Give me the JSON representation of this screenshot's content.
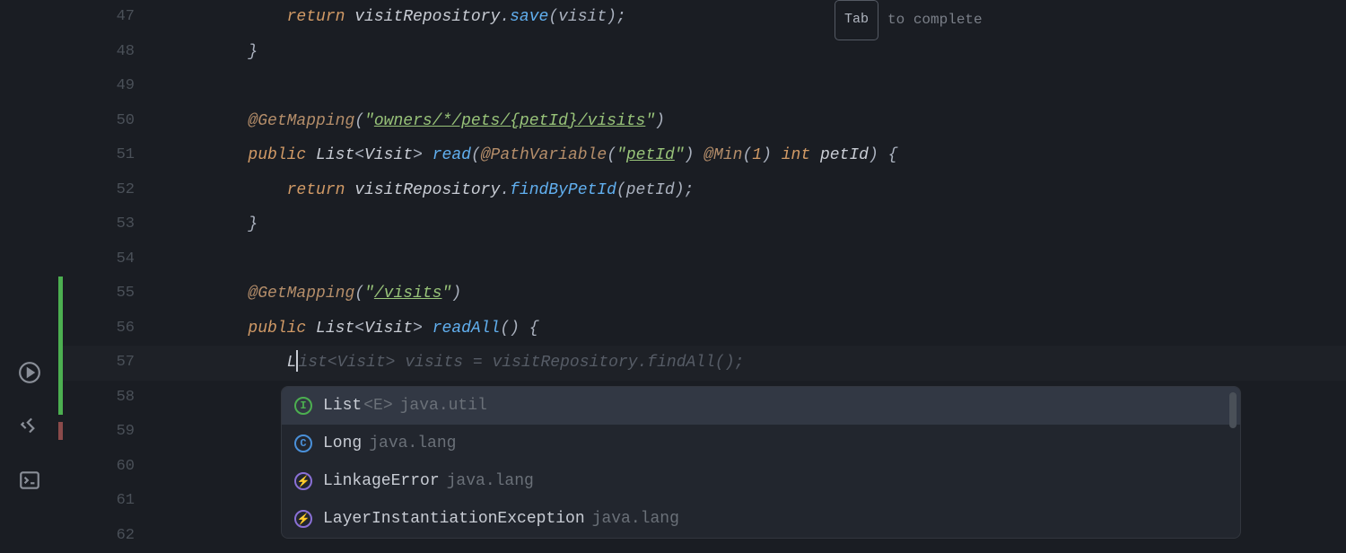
{
  "gutter": {
    "lines": [
      "47",
      "48",
      "49",
      "50",
      "51",
      "52",
      "53",
      "54",
      "55",
      "56",
      "57",
      "58",
      "59",
      "60",
      "61",
      "62"
    ],
    "markers": {
      "51": "web-icon",
      "56": "web-icon"
    },
    "change_bars": [
      {
        "from": "55",
        "to": "58",
        "kind": "add"
      },
      {
        "from": "59",
        "to": "59",
        "kind": "del"
      }
    ]
  },
  "code": {
    "l47": {
      "indent": "            ",
      "kw": "return",
      "sp": " ",
      "var": "visitRepository",
      "dot": ".",
      "method": "save",
      "args": "(visit);"
    },
    "l48": {
      "indent": "        ",
      "brace": "}"
    },
    "l49": {
      "text": ""
    },
    "l50": {
      "indent": "        ",
      "ann": "@GetMapping",
      "open": "(",
      "q1": "\"",
      "path": "owners/*/pets/{petId}/visits",
      "q2": "\"",
      "close": ")"
    },
    "l51": {
      "indent": "        ",
      "kw": "public",
      "sp": " ",
      "type1": "List",
      "lt": "<",
      "type2": "Visit",
      "gt": ">",
      "sp2": " ",
      "method": "read",
      "open": "(",
      "ann": "@PathVariable",
      "open2": "(",
      "q1": "\"",
      "pv": "petId",
      "q2": "\"",
      "close2": ")",
      "sp3": " ",
      "ann2": "@Min",
      "open3": "(",
      "num": "1",
      "close3": ")",
      "sp4": " ",
      "ptype": "int",
      "sp5": " ",
      "pname": "petId",
      "close": ") {"
    },
    "l52": {
      "indent": "            ",
      "kw": "return",
      "sp": " ",
      "var": "visitRepository",
      "dot": ".",
      "method": "findByPetId",
      "args": "(petId);"
    },
    "l53": {
      "indent": "        ",
      "brace": "}"
    },
    "l54": {
      "text": ""
    },
    "l55": {
      "indent": "        ",
      "ann": "@GetMapping",
      "open": "(",
      "q1": "\"",
      "path": "/visits",
      "q2": "\"",
      "close": ")"
    },
    "l56": {
      "indent": "        ",
      "kw": "public",
      "sp": " ",
      "type1": "List",
      "lt": "<",
      "type2": "Visit",
      "gt": ">",
      "sp2": " ",
      "method": "readAll",
      "rest": "() {"
    },
    "l57": {
      "indent": "            ",
      "typed": "L",
      "ghost": "ist<Visit> visits = visitRepository.findAll();"
    },
    "l58": {
      "text": ""
    },
    "l59": {
      "text": ""
    },
    "l60": {
      "text": ""
    },
    "l61": {
      "text": ""
    }
  },
  "inline_hint": {
    "key": "Tab",
    "text": "to complete"
  },
  "completion": {
    "items": [
      {
        "icon": "I",
        "icon_kind": "interface",
        "name": "List",
        "generic": "<E>",
        "pkg": "java.util",
        "selected": true
      },
      {
        "icon": "C",
        "icon_kind": "class",
        "name": "Long",
        "generic": "",
        "pkg": "java.lang",
        "selected": false
      },
      {
        "icon": "⚡",
        "icon_kind": "excep",
        "name": "LinkageError",
        "generic": "",
        "pkg": "java.lang",
        "selected": false
      },
      {
        "icon": "⚡",
        "icon_kind": "excep",
        "name": "LayerInstantiationException",
        "generic": "",
        "pkg": "java.lang",
        "selected": false
      }
    ]
  },
  "activity_icons": [
    "run-icon",
    "build-icon",
    "terminal-icon"
  ]
}
